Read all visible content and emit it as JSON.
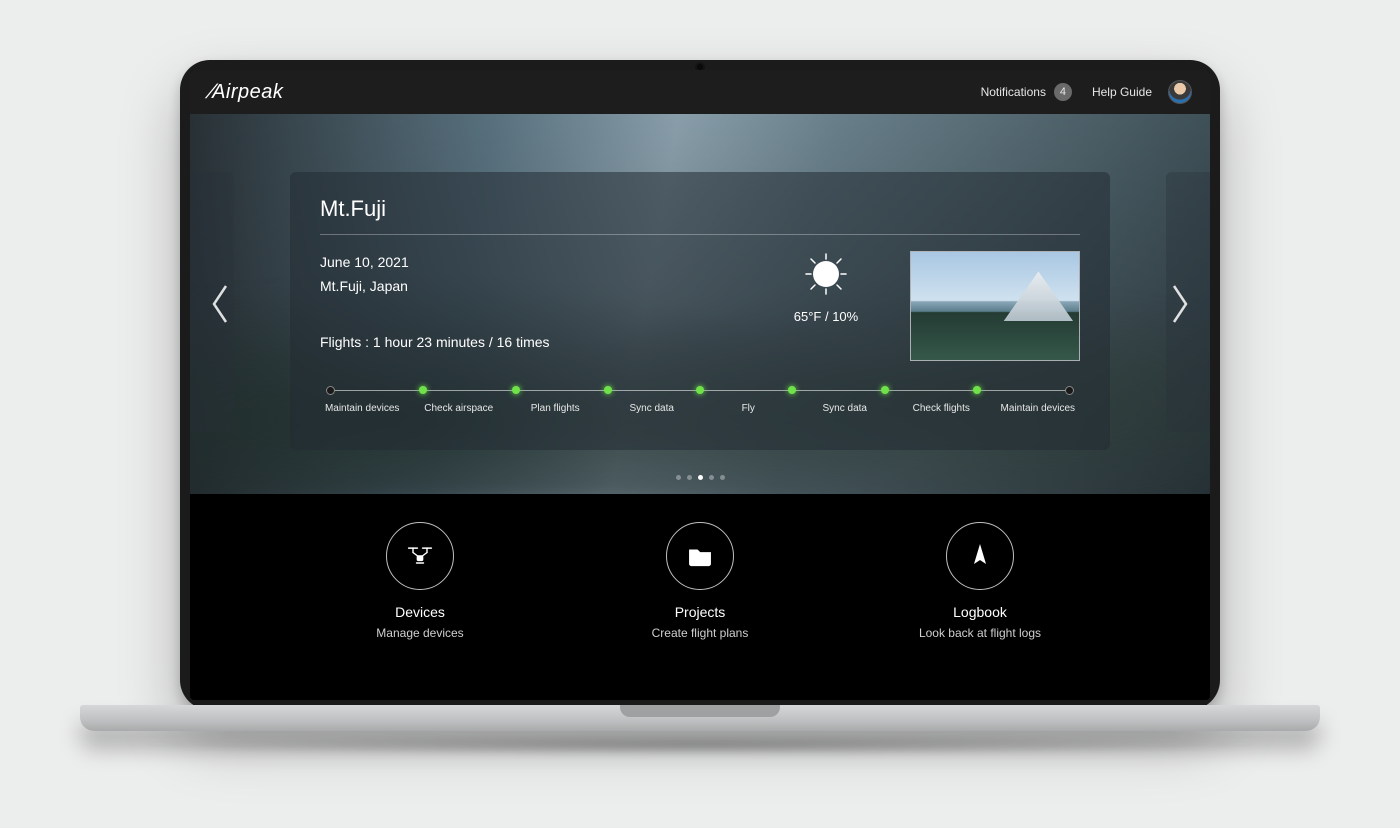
{
  "brand": "Airpeak",
  "topbar": {
    "notifications_label": "Notifications",
    "notifications_count": "4",
    "help_label": "Help Guide"
  },
  "card": {
    "title": "Mt.Fuji",
    "date": "June 10, 2021",
    "location": "Mt.Fuji, Japan",
    "flights_line": "Flights : 1 hour 23 minutes  / 16 times",
    "weather_line": "65°F / 10%"
  },
  "pipeline": {
    "steps": [
      "Maintain devices",
      "Check airspace",
      "Plan flights",
      "Sync data",
      "Fly",
      "Sync data",
      "Check flights",
      "Maintain devices"
    ]
  },
  "pager": {
    "count": 5,
    "active_index": 2
  },
  "actions": [
    {
      "icon": "drone-icon",
      "title": "Devices",
      "sub": "Manage devices"
    },
    {
      "icon": "folder-icon",
      "title": "Projects",
      "sub": "Create flight plans"
    },
    {
      "icon": "compass-icon",
      "title": "Logbook",
      "sub": "Look back at flight logs"
    }
  ]
}
